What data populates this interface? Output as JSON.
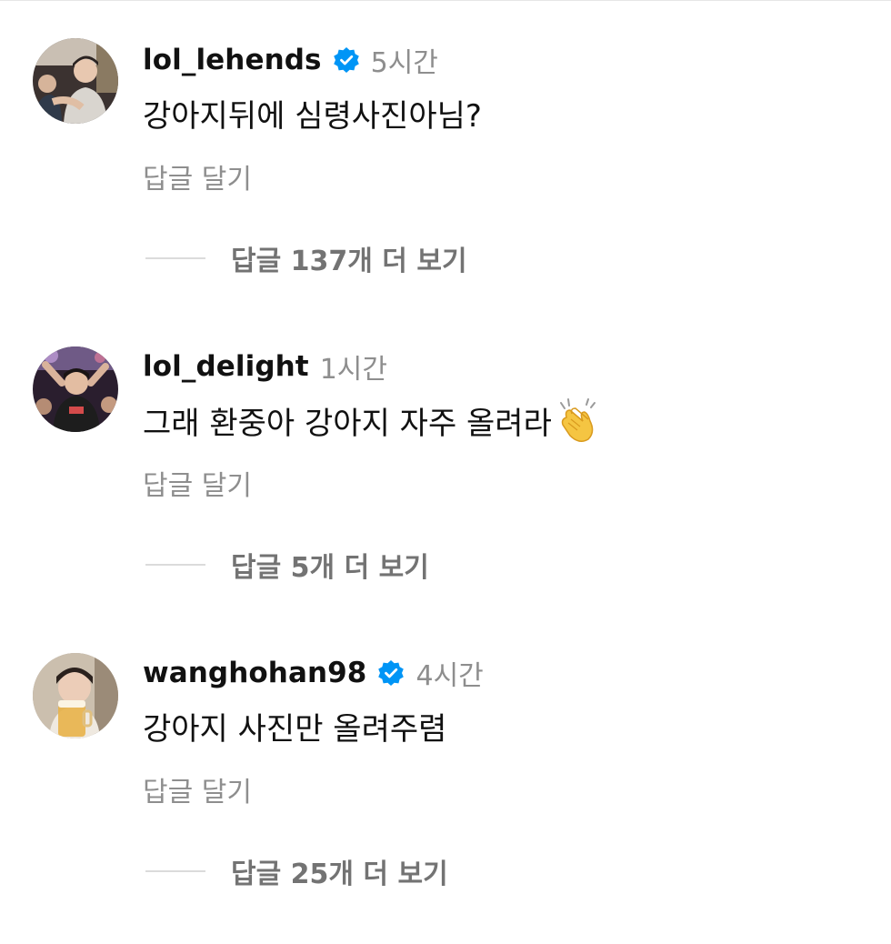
{
  "comments": [
    {
      "username": "lol_lehends",
      "verified": true,
      "timestamp": "5시간",
      "text": "강아지뒤에 심령사진아님?",
      "emoji": "",
      "reply_label": "답글 달기",
      "view_replies_label": "답글 137개 더 보기",
      "avatar_icon": "profile-photo"
    },
    {
      "username": "lol_delight",
      "verified": false,
      "timestamp": "1시간",
      "text": "그래 환중아 강아지 자주 올려라",
      "emoji": "clapping-hands",
      "reply_label": "답글 달기",
      "view_replies_label": "답글 5개 더 보기",
      "avatar_icon": "profile-photo"
    },
    {
      "username": "wanghohan98",
      "verified": true,
      "timestamp": "4시간",
      "text": "강아지 사진만 올려주렴",
      "emoji": "",
      "reply_label": "답글 달기",
      "view_replies_label": "답글 25개 더 보기",
      "avatar_icon": "profile-photo"
    }
  ],
  "colors": {
    "verified_badge": "#0095f6",
    "secondary_text": "#8e8e8e",
    "view_replies_text": "#737373",
    "divider": "#dbdbdb"
  }
}
